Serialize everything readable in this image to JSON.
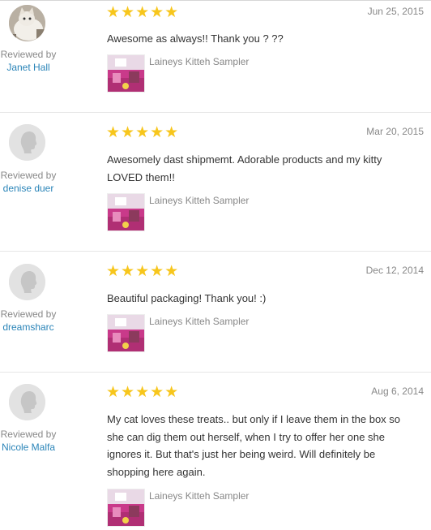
{
  "reviews": [
    {
      "reviewed_by_label": "Reviewed by",
      "reviewer": "Janet Hall",
      "date": "Jun 25, 2015",
      "stars": "★★★★★",
      "rating": 5,
      "text": "Awesome as always!! Thank you ? ??",
      "product": "Laineys Kitteh Sampler",
      "avatar": "cat-photo"
    },
    {
      "reviewed_by_label": "Reviewed by",
      "reviewer": "denise duer",
      "date": "Mar 20, 2015",
      "stars": "★★★★★",
      "rating": 5,
      "text": "Awesomely dast shipmemt. Adorable products and my kitty LOVED them!!",
      "product": "Laineys Kitteh Sampler",
      "avatar": "default-silhouette"
    },
    {
      "reviewed_by_label": "Reviewed by",
      "reviewer": "dreamsharc",
      "date": "Dec 12, 2014",
      "stars": "★★★★★",
      "rating": 5,
      "text": "Beautiful packaging! Thank you! :)",
      "product": "Laineys Kitteh Sampler",
      "avatar": "default-silhouette"
    },
    {
      "reviewed_by_label": "Reviewed by",
      "reviewer": "Nicole Malfa",
      "date": "Aug 6, 2014",
      "stars": "★★★★★",
      "rating": 5,
      "text": "My cat loves these treats.. but only if I leave them in the box so she can dig them out herself, when I try to offer her one she ignores it. But that's just her being weird. Will definitely be shopping here again.",
      "product": "Laineys Kitteh Sampler",
      "avatar": "default-silhouette"
    }
  ],
  "colors": {
    "star": "#f7c61c",
    "link": "#2a84b8",
    "muted": "#888888",
    "text": "#333333"
  }
}
